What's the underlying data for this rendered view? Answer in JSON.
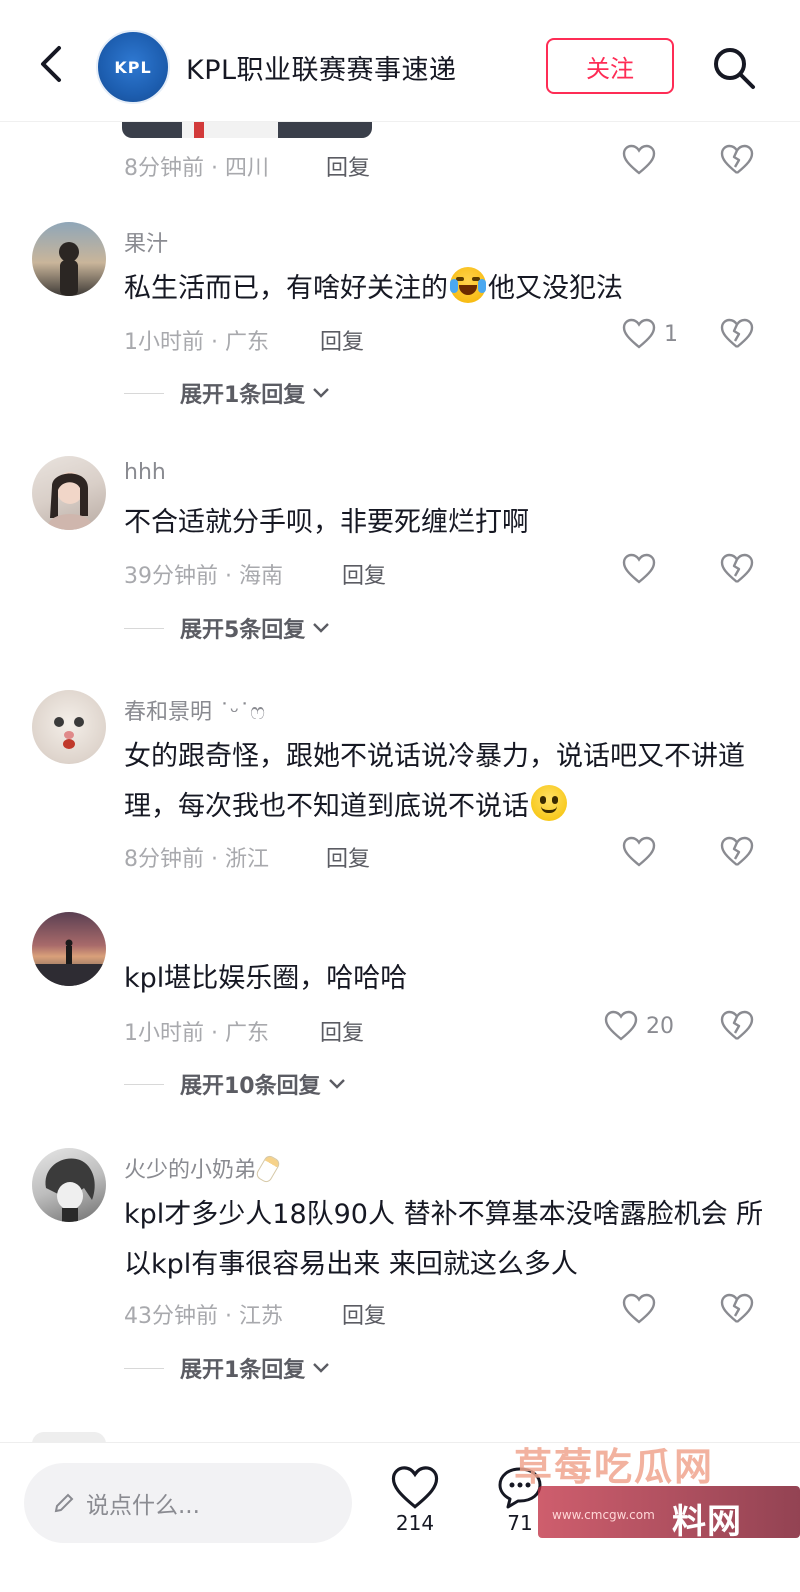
{
  "header": {
    "title": "KPL职业联赛赛事速递",
    "logo_text": "KPL",
    "follow_label": "关注"
  },
  "comments": [
    {
      "username": "",
      "text": "",
      "time": "8分钟前 · 四川",
      "reply_label": "回复",
      "likes": ""
    },
    {
      "username": "果汁",
      "text_before": "私生活而已，有啥好关注的",
      "text_after": "他又没犯法",
      "time": "1小时前 · 广东",
      "reply_label": "回复",
      "likes": "1",
      "expand_label": "展开1条回复"
    },
    {
      "username": "hhh",
      "text": "不合适就分手呗，非要死缠烂打啊",
      "time": "39分钟前 · 海南",
      "reply_label": "回复",
      "likes": "",
      "expand_label": "展开5条回复"
    },
    {
      "username": "春和景明 ˙ᵕ˙ෆ",
      "text": "女的跟奇怪，跟她不说话说冷暴力，说话吧又不讲道理，每次我也不知道到底说不说话",
      "time": "8分钟前 · 浙江",
      "reply_label": "回复",
      "likes": ""
    },
    {
      "username": "",
      "text": "kpl堪比娱乐圈，哈哈哈",
      "time": "1小时前 · 广东",
      "reply_label": "回复",
      "likes": "20",
      "expand_label": "展开10条回复"
    },
    {
      "username": "火少的小奶弟",
      "text": "kpl才多少人18队90人 替补不算基本没啥露脸机会 所以kpl有事很容易出来 来回就这么多人",
      "time": "43分钟前 · 江苏",
      "reply_label": "回复",
      "likes": "",
      "expand_label": "展开1条回复"
    }
  ],
  "bottom": {
    "input_placeholder": "说点什么...",
    "like_count": "214",
    "comment_count": "71"
  },
  "watermark": {
    "top_text": "草莓吃瓜网",
    "bar_text": "料网",
    "url": "www.cmcgw.com"
  },
  "colors": {
    "accent": "#fe2c55",
    "logo_blue": "#1d5eb0",
    "muted_text": "#a8a9ad"
  }
}
